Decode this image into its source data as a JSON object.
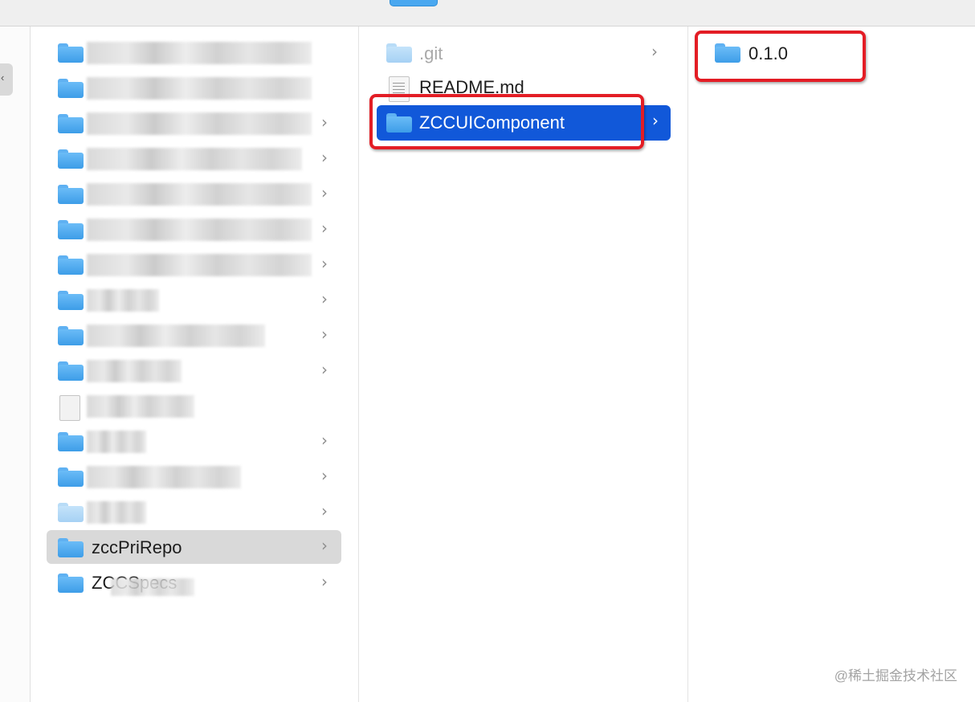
{
  "browser_column": {
    "items": [
      {
        "label": "",
        "blurred": true,
        "has_chevron": false
      },
      {
        "label": "",
        "blurred": true,
        "has_chevron": false
      },
      {
        "label": "",
        "blurred": true,
        "has_chevron": true
      },
      {
        "label": "",
        "blurred": true,
        "has_chevron": true
      },
      {
        "label": "",
        "blurred": true,
        "has_chevron": true
      },
      {
        "label": "",
        "blurred": true,
        "has_chevron": true
      },
      {
        "label": "",
        "blurred": true,
        "has_chevron": true
      },
      {
        "label": "",
        "blurred": true,
        "has_chevron": true
      },
      {
        "label": "",
        "blurred": true,
        "has_chevron": true
      },
      {
        "label": "",
        "blurred": true,
        "has_chevron": true
      },
      {
        "label": "",
        "blurred": true,
        "has_chevron": false
      },
      {
        "label": "",
        "blurred": true,
        "has_chevron": true
      },
      {
        "label": "",
        "blurred": true,
        "has_chevron": true
      },
      {
        "label": "",
        "blurred": true,
        "has_chevron": true
      },
      {
        "label": "zccPriRepo",
        "blurred": false,
        "has_chevron": true,
        "selected": true
      },
      {
        "label": "ZCCSpecs",
        "blurred": false,
        "has_chevron": true
      }
    ]
  },
  "repo_column": {
    "items": [
      {
        "label": ".git",
        "icon": "folder-icon",
        "dimmed": true,
        "has_chevron": true
      },
      {
        "label": "README.md",
        "icon": "document-icon",
        "dimmed": false,
        "has_chevron": false
      },
      {
        "label": "ZCCUIComponent",
        "icon": "folder-icon",
        "selected": true,
        "has_chevron": true
      }
    ]
  },
  "component_column": {
    "items": [
      {
        "label": "0.1.0",
        "icon": "folder-icon"
      }
    ]
  },
  "chevron_glyph": "›",
  "watermark": "@稀土掘金技术社区",
  "colors": {
    "selection_blue": "#1158d9",
    "selection_gray": "#d9d9d9",
    "highlight_red": "#e31d25",
    "folder_blue": "#3d9de8"
  }
}
